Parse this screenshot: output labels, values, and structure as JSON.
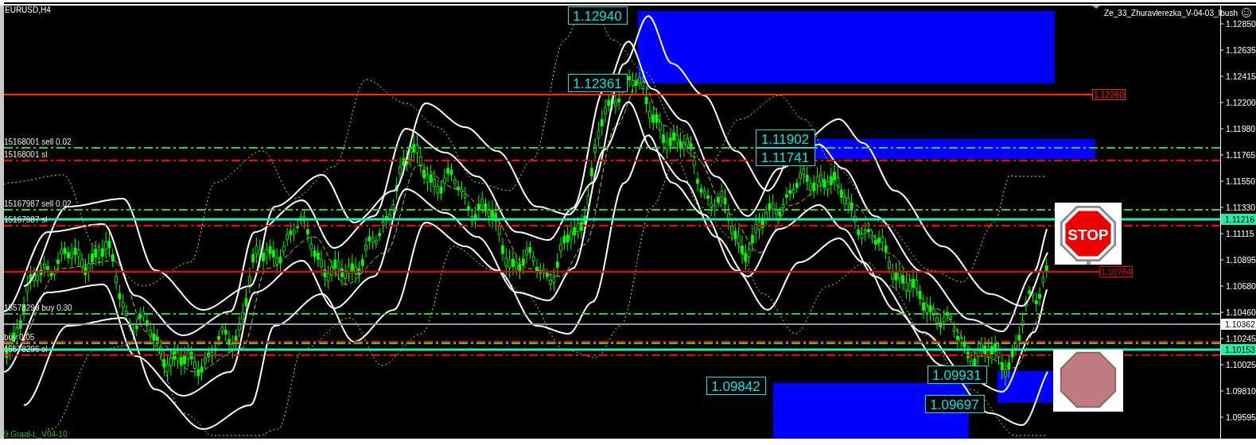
{
  "symbol": "EURUSD,H4",
  "expert_name": "Ze_33_Zhuravlerezka_V-04-03_Ibush",
  "indicator_label": "9 Graal-L_V04-10",
  "price_axis": [
    "1.12850",
    "1.12635",
    "1.12415",
    "1.12200",
    "1.11980",
    "1.11765",
    "1.11550",
    "1.11330",
    "1.11115",
    "1.10895",
    "1.10680",
    "1.10460",
    "1.10245",
    "1.10025",
    "1.09810",
    "1.09595"
  ],
  "levels": [
    {
      "kind": "level",
      "color": "#ff2a00",
      "tag": {
        "kind": "box",
        "text": "1.12260"
      }
    },
    {
      "kind": "order",
      "color": "#33cc33",
      "note": "15168001 sell 0.02"
    },
    {
      "kind": "order",
      "color": "#ff0000",
      "note": "15168001 sl"
    },
    {
      "kind": "order",
      "color": "#33cc33",
      "note": "15167987 sell 0.02"
    },
    {
      "kind": "level",
      "color": "#22eeaa",
      "tag": {
        "kind": "axis",
        "text": "1.11216"
      }
    },
    {
      "kind": "order",
      "color": "#ff0000",
      "note": "15167987 sl"
    },
    {
      "kind": "level",
      "color": "#ff0000",
      "tag": {
        "kind": "box",
        "text": "1.10784"
      }
    },
    {
      "kind": "order",
      "color": "#33cc33",
      "note": "15578296 buy 0.30"
    },
    {
      "kind": "level",
      "color": "#8d98a6",
      "tag": {
        "kind": "axis",
        "text": "1.10362"
      }
    },
    {
      "kind": "order",
      "color": "#ff0000"
    },
    {
      "kind": "order",
      "color": "#33cc33",
      "note": "buy 0.05"
    },
    {
      "kind": "level",
      "color": "#22eeaa",
      "tag": {
        "kind": "axis",
        "text": "1.10153"
      }
    },
    {
      "kind": "order",
      "color": "#ff0000",
      "note": "15578296 sl"
    }
  ],
  "price_labels": [
    "1.12940",
    "1.12361",
    "1.11902",
    "1.11741",
    "1.09842",
    "1.09931",
    "1.09697"
  ],
  "stop_sign": {
    "text": "STOP"
  }
}
